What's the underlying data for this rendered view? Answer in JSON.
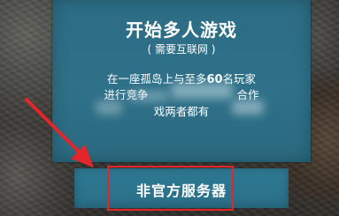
{
  "panel": {
    "title": "开始多人游戏",
    "subtitle": "( 需要互联网 )",
    "description": {
      "line1_prefix": "在一座孤岛上与至多",
      "line1_number": "60",
      "line1_suffix": "名玩家",
      "line2_left": "进行竞争",
      "line2_right": "合作",
      "line3": "戏两者都有"
    }
  },
  "buttons": {
    "unofficial_servers": "非官方服务器"
  },
  "annotation": {
    "highlight_color": "#e3262b",
    "arrow_color": "#e3262b"
  },
  "colors": {
    "panel": "#2f7189",
    "button": "#2c7490"
  }
}
